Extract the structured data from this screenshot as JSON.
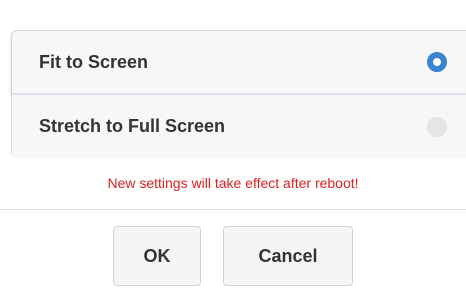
{
  "options": [
    {
      "label": "Fit to Screen",
      "selected": true
    },
    {
      "label": "Stretch to Full Screen",
      "selected": false
    }
  ],
  "notice": "New settings will take effect after reboot!",
  "buttons": {
    "ok_label": "OK",
    "cancel_label": "Cancel"
  },
  "colors": {
    "accent": "#3a84d1",
    "notice": "#e02020",
    "text": "#333333"
  }
}
